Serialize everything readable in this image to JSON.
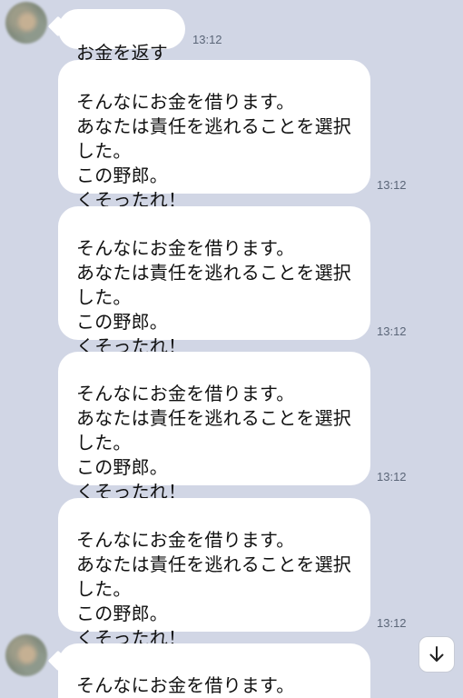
{
  "chat": {
    "first_message": {
      "text": "お金を返す",
      "time": "13:12"
    },
    "messages": [
      {
        "text": "そんなにお金を借ります。\nあなたは責任を逃れることを選択\nした。\nこの野郎。\nくそったれ！",
        "time": "13:12"
      },
      {
        "text": "そんなにお金を借ります。\nあなたは責任を逃れることを選択\nした。\nこの野郎。\nくそったれ！",
        "time": "13:12"
      },
      {
        "text": "そんなにお金を借ります。\nあなたは責任を逃れることを選択\nした。\nこの野郎。\nくそったれ！",
        "time": "13:12"
      },
      {
        "text": "そんなにお金を借ります。\nあなたは責任を逃れることを選択\nした。\nこの野郎。\nくそったれ！",
        "time": "13:12"
      }
    ],
    "last_message": {
      "text": "そんなにお金を借ります。"
    }
  },
  "scroll_button": {
    "icon": "arrow-down-icon"
  },
  "colors": {
    "background": "#d1d6e5",
    "bubble": "#ffffff",
    "text": "#111111",
    "timestamp": "#5b6678"
  }
}
